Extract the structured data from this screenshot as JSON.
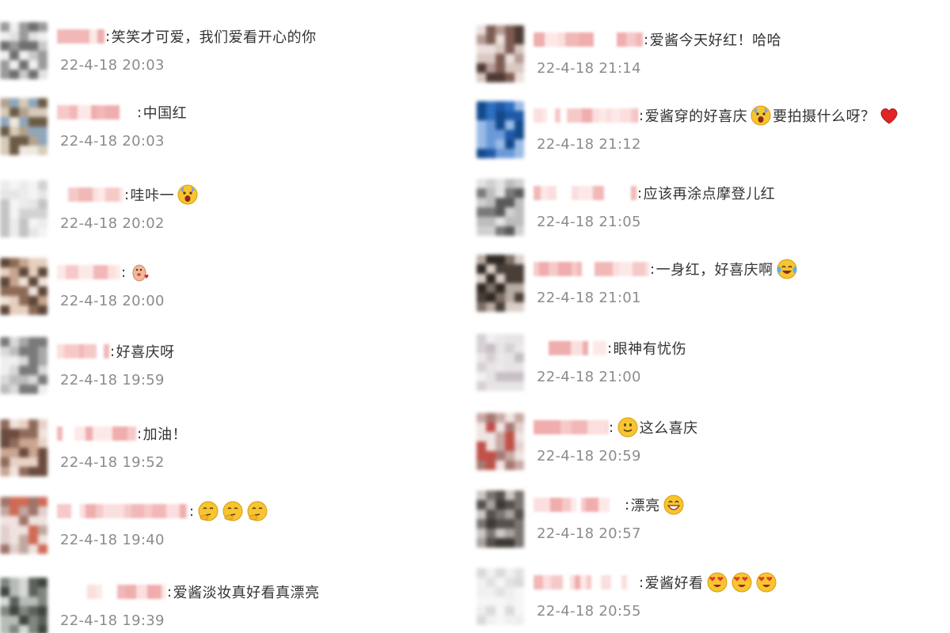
{
  "comments_left": [
    {
      "text": "笑笑才可爱，我们爱看开心的你",
      "emojis": [],
      "time": "22-4-18 20:03"
    },
    {
      "text": "中国红",
      "emojis": [],
      "time": "22-4-18 20:03"
    },
    {
      "text": "哇咔一",
      "emojis": [
        "scream-emoji"
      ],
      "time": "22-4-18 20:02"
    },
    {
      "text": "",
      "emojis": [
        "doge-heart-emoji"
      ],
      "time": "22-4-18 20:00"
    },
    {
      "text": "好喜庆呀",
      "emojis": [],
      "time": "22-4-18 19:59"
    },
    {
      "text": "加油！",
      "emojis": [],
      "time": "22-4-18 19:52"
    },
    {
      "text": "",
      "emojis": [
        "thinking-emoji",
        "thinking-emoji",
        "thinking-emoji"
      ],
      "time": "22-4-18 19:40"
    },
    {
      "text": "爱酱淡妆真好看真漂亮",
      "emojis": [],
      "time": "22-4-18 19:39"
    }
  ],
  "comments_right": [
    {
      "text": "爱酱今天好红！哈哈",
      "emojis": [],
      "time": "22-4-18 21:14"
    },
    {
      "text": "爱酱穿的好喜庆",
      "emojis": [
        "scream-emoji"
      ],
      "text_after": "要拍摄什么呀？",
      "emojis_after": [
        "red-heart-emoji"
      ],
      "time": "22-4-18 21:12"
    },
    {
      "text": "应该再涂点摩登儿红",
      "emojis": [],
      "time": "22-4-18 21:05"
    },
    {
      "text": "一身红，好喜庆啊",
      "emojis": [
        "laugh-cry-emoji"
      ],
      "time": "22-4-18 21:01"
    },
    {
      "text": "眼神有忧伤",
      "emojis": [],
      "time": "22-4-18 21:00"
    },
    {
      "text": "",
      "emojis": [
        "smile-emoji"
      ],
      "text_after": "这么喜庆",
      "time": "22-4-18 20:59"
    },
    {
      "text": "漂亮",
      "emojis": [
        "grin-emoji"
      ],
      "time": "22-4-18 20:57"
    },
    {
      "text": "爱酱好看",
      "emojis": [
        "heart-eyes-emoji",
        "heart-eyes-emoji",
        "heart-eyes-emoji"
      ],
      "time": "22-4-18 20:55"
    }
  ],
  "colors": {
    "text": "#333333",
    "time": "#8c8c8c",
    "background": "#ffffff",
    "blurred_name": "#f5c6c6"
  }
}
